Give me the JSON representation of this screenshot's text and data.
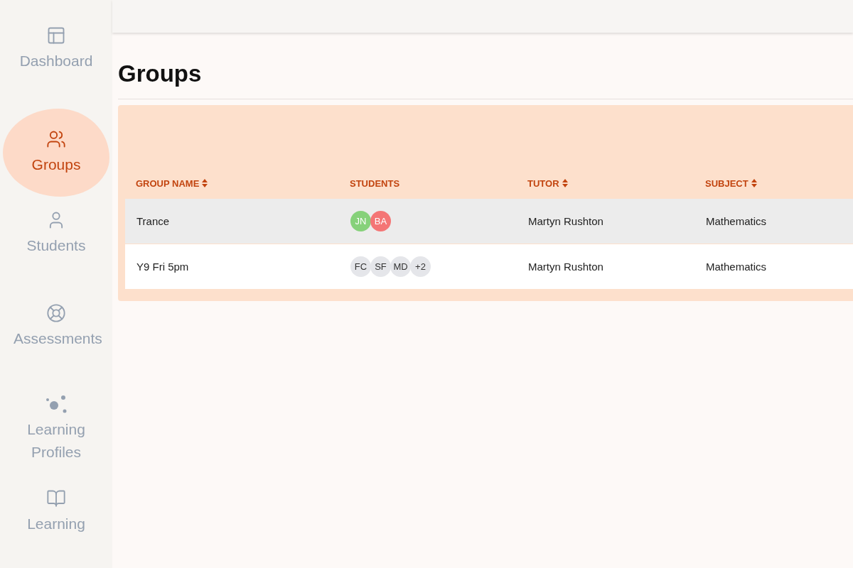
{
  "sidebar": {
    "items": [
      {
        "label": "Dashboard",
        "kind": "dashboard",
        "selected": false
      },
      {
        "label": "Groups",
        "kind": "groups",
        "selected": true
      },
      {
        "label": "Students",
        "kind": "students",
        "selected": false
      },
      {
        "label": "Assessments",
        "kind": "assessments",
        "selected": false
      },
      {
        "label": "Learning Profiles",
        "kind": "profiles",
        "selected": false
      },
      {
        "label": "Learning",
        "kind": "learning",
        "selected": false
      }
    ]
  },
  "page": {
    "title": "Groups"
  },
  "table": {
    "columns": [
      {
        "label": "GROUP NAME",
        "sortable": true
      },
      {
        "label": "STUDENTS",
        "sortable": false
      },
      {
        "label": "TUTOR",
        "sortable": true
      },
      {
        "label": "SUBJECT",
        "sortable": true
      }
    ],
    "rows": [
      {
        "group_name": "Trance",
        "students": [
          {
            "initials": "JN",
            "color": "#86d17a"
          },
          {
            "initials": "BA",
            "color": "#f47575"
          }
        ],
        "tutor": "Martyn Rushton",
        "subject": "Mathematics",
        "selected": true
      },
      {
        "group_name": "Y9 Fri 5pm",
        "students": [
          {
            "initials": "FC",
            "color": "#e5e6ea"
          },
          {
            "initials": "SF",
            "color": "#e5e6ea"
          },
          {
            "initials": "MD",
            "color": "#e5e6ea"
          },
          {
            "initials": "+2",
            "color": "#e5e6ea"
          }
        ],
        "tutor": "Martyn Rushton",
        "subject": "Mathematics",
        "selected": false
      }
    ]
  }
}
